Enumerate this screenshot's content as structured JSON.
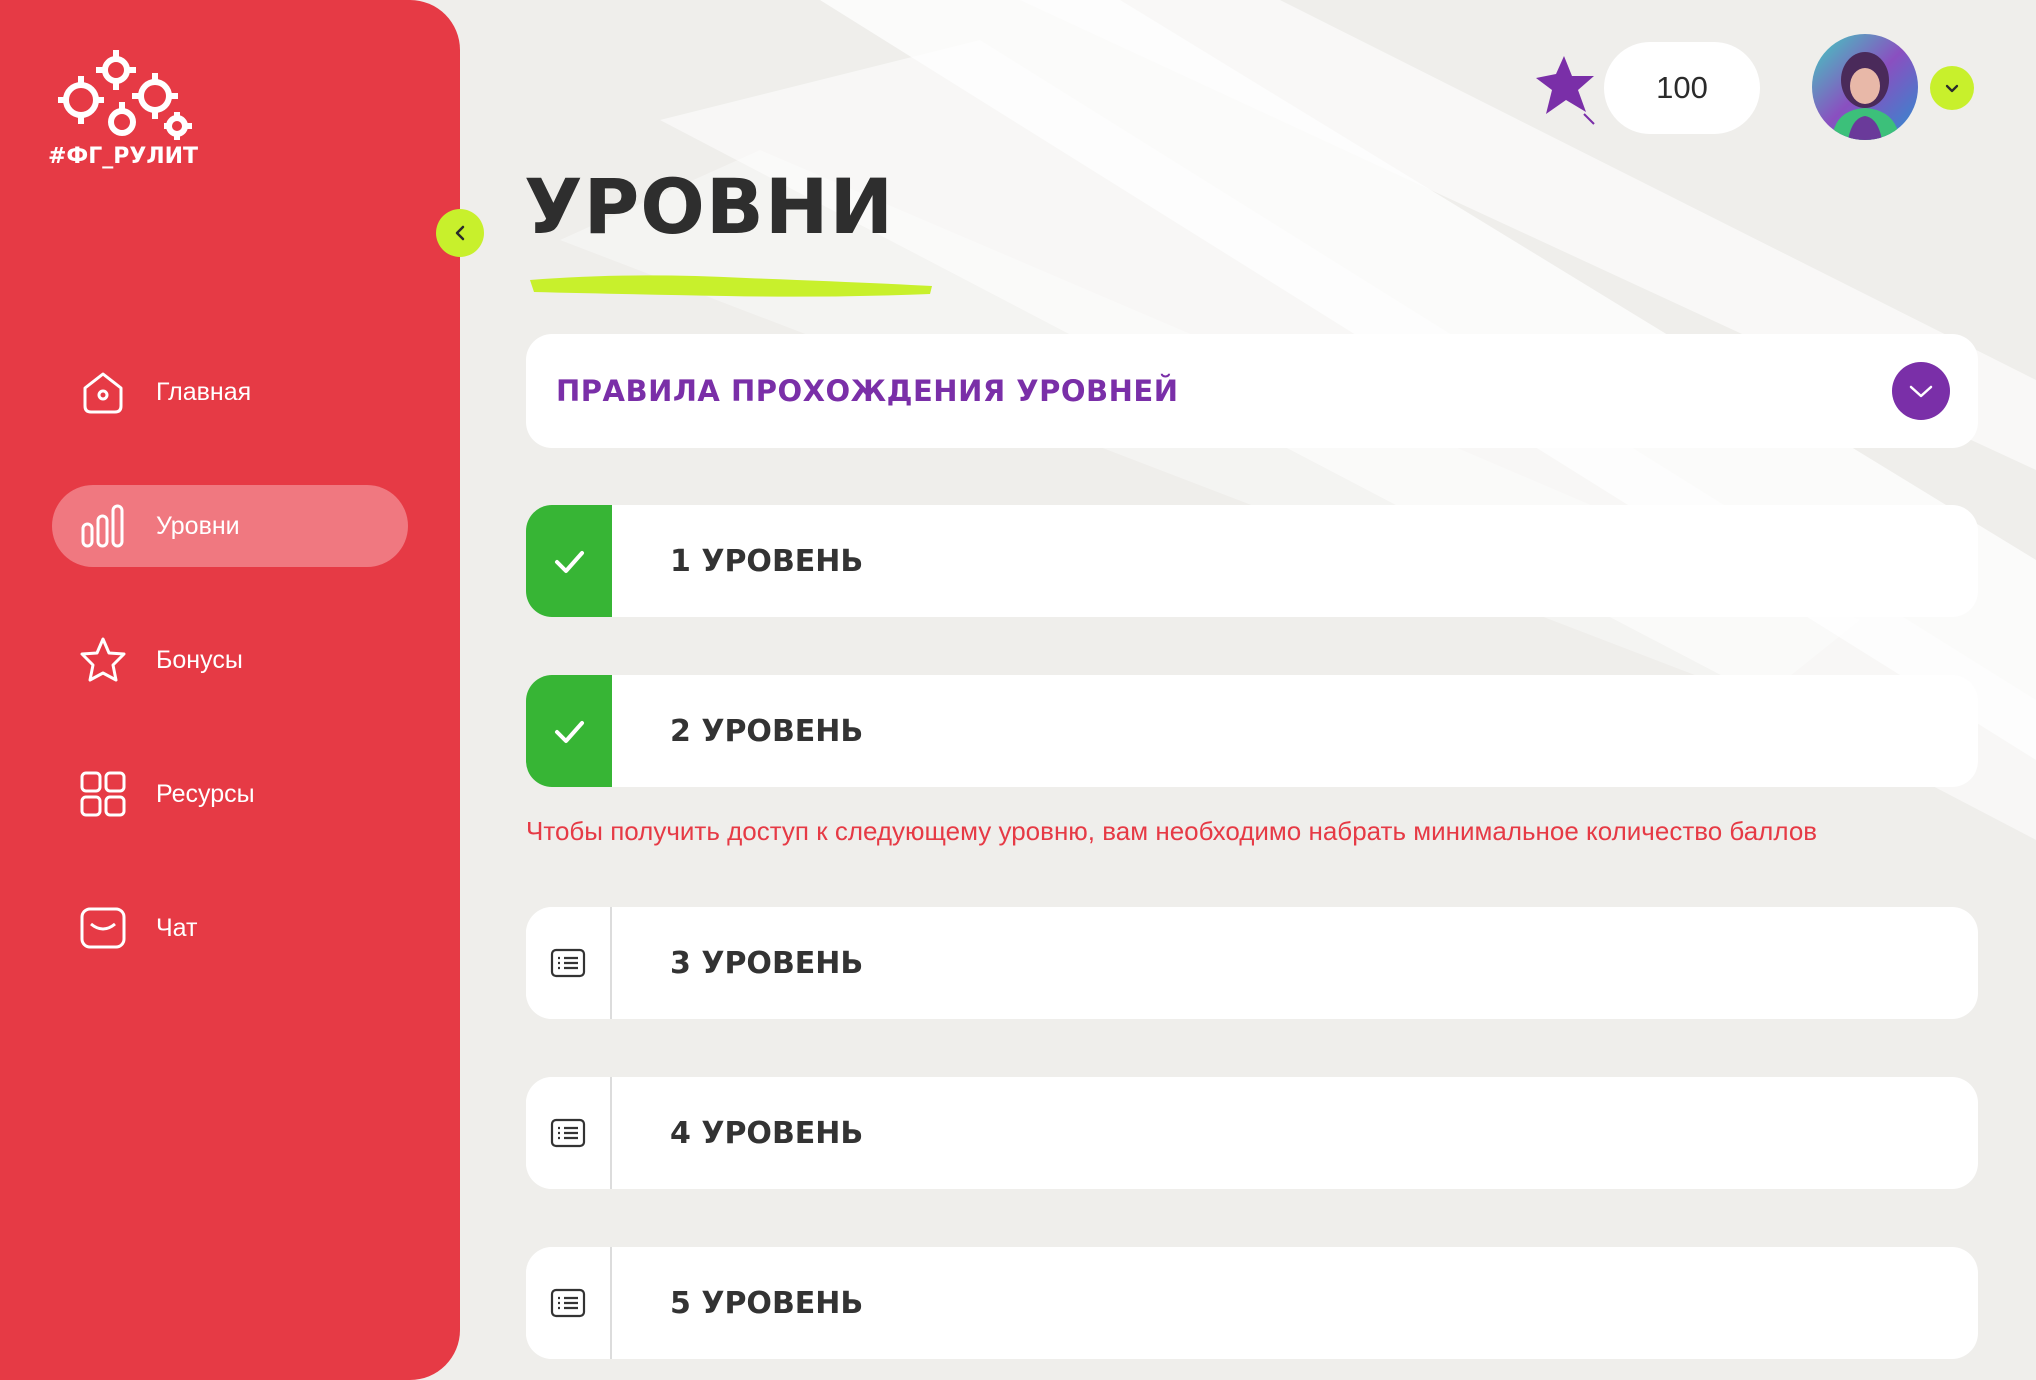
{
  "brand": {
    "logo_text": "#ФГ_РУЛИТ"
  },
  "sidebar": {
    "items": [
      {
        "label": "Главная",
        "icon": "home-icon",
        "active": false
      },
      {
        "label": "Уровни",
        "icon": "levels-icon",
        "active": true
      },
      {
        "label": "Бонусы",
        "icon": "star-icon",
        "active": false
      },
      {
        "label": "Ресурсы",
        "icon": "grid-icon",
        "active": false
      },
      {
        "label": "Чат",
        "icon": "chat-icon",
        "active": false
      }
    ]
  },
  "header": {
    "points": "100"
  },
  "page": {
    "title": "УРОВНИ",
    "rules_label": "ПРАВИЛА ПРОХОЖДЕНИЯ УРОВНЕЙ",
    "notice": "Чтобы получить доступ к следующему уровню, вам необходимо набрать минимальное количество баллов"
  },
  "levels": [
    {
      "label": "1 УРОВЕНЬ",
      "status": "completed"
    },
    {
      "label": "2 УРОВЕНЬ",
      "status": "completed"
    },
    {
      "label": "3 УРОВЕНЬ",
      "status": "locked"
    },
    {
      "label": "4 УРОВЕНЬ",
      "status": "locked"
    },
    {
      "label": "5 УРОВЕНЬ",
      "status": "locked"
    }
  ],
  "colors": {
    "sidebar": "#e63a45",
    "accent_lime": "#c8f02c",
    "accent_purple": "#7a2fa8",
    "success": "#37b535",
    "background": "#efeeeb"
  }
}
